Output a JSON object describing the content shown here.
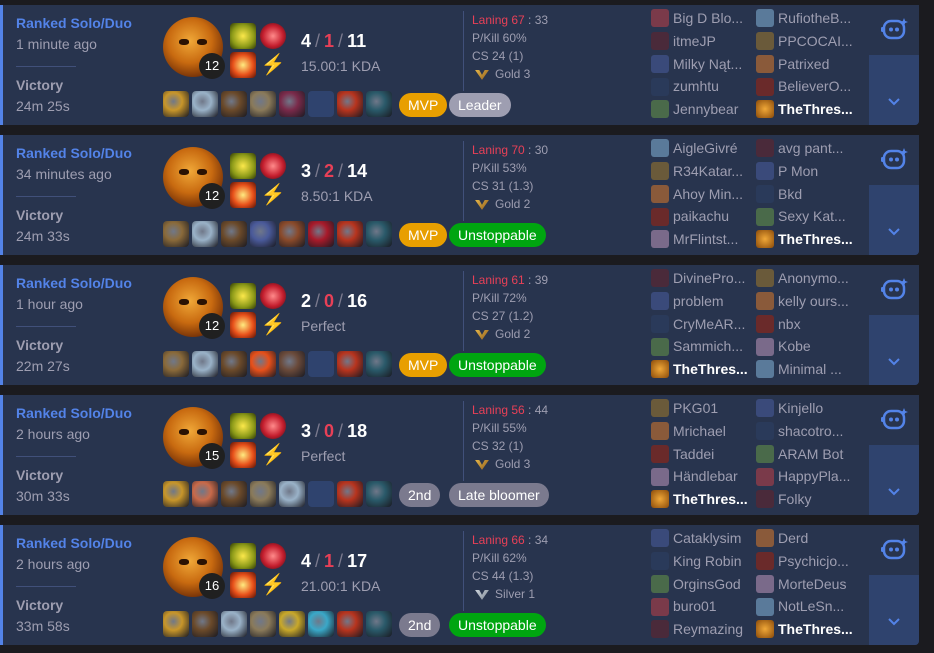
{
  "colors": {
    "accent": "#5383e8",
    "deaths": "#e84057",
    "mvp": "#e89f00",
    "second": "#7b7a8e",
    "green": "#00a510",
    "background": "#28344e"
  },
  "icons": {
    "ai": "ai-assistant-icon",
    "expand": "chevron-down-icon",
    "rank": "rank-emblem-icon"
  },
  "matches": [
    {
      "queue": "Ranked Solo/Duo",
      "ago": "1 minute ago",
      "result": "Victory",
      "duration": "24m 25s",
      "level": "12",
      "kills": "4",
      "deaths": "1",
      "assists": "11",
      "ratio": "15.00:1 KDA",
      "lane_label": "Laning 67",
      "lane_other": "33",
      "pkill": "P/Kill 60%",
      "cs": "CS 24 (1)",
      "rank": "Gold 3",
      "rank_tier": "gold",
      "badges": [
        {
          "label": "MVP",
          "type": "mvp"
        },
        {
          "label": "Leader",
          "type": "grey"
        }
      ],
      "items": [
        "#c8962a",
        "#9ab2c8",
        "#6b4a2a",
        "#8a7a5a",
        "#7a2a4a",
        "",
        "#b8341e",
        "#2a5a6a"
      ],
      "players": [
        [
          "Big D Blo...",
          "RufiotheB..."
        ],
        [
          "itmeJP",
          "PPCOCAI..."
        ],
        [
          "Milky Nąt...",
          "Patrixed"
        ],
        [
          "zumhtu",
          "BelieverO..."
        ],
        [
          "Jennybear",
          "TheThres..."
        ]
      ],
      "me": [
        4,
        1
      ]
    },
    {
      "queue": "Ranked Solo/Duo",
      "ago": "34 minutes ago",
      "result": "Victory",
      "duration": "24m 33s",
      "level": "12",
      "kills": "3",
      "deaths": "2",
      "assists": "14",
      "ratio": "8.50:1 KDA",
      "lane_label": "Laning 70",
      "lane_other": "30",
      "pkill": "P/Kill 53%",
      "cs": "CS 31 (1.3)",
      "rank": "Gold 2",
      "rank_tier": "gold",
      "badges": [
        {
          "label": "MVP",
          "type": "mvp"
        },
        {
          "label": "Unstoppable",
          "type": "green"
        }
      ],
      "items": [
        "#8a6a3a",
        "#9ab2c8",
        "#6b4a2a",
        "#4a5a9a",
        "#8a4a2a",
        "#a81a2a",
        "#b8341e",
        "#2a5a6a"
      ],
      "players": [
        [
          "AigleGivré",
          "avg pant..."
        ],
        [
          "R34Katar...",
          "P Mon"
        ],
        [
          "Ahoy Min...",
          "Bkd"
        ],
        [
          "paikachu",
          "Sexy Kat..."
        ],
        [
          "MrFlintst...",
          "TheThres..."
        ]
      ],
      "me": [
        4,
        1
      ]
    },
    {
      "queue": "Ranked Solo/Duo",
      "ago": "1 hour ago",
      "result": "Victory",
      "duration": "22m 27s",
      "level": "12",
      "kills": "2",
      "deaths": "0",
      "assists": "16",
      "ratio": "Perfect",
      "lane_label": "Laning 61",
      "lane_other": "39",
      "pkill": "P/Kill 72%",
      "cs": "CS 27 (1.2)",
      "rank": "Gold 2",
      "rank_tier": "gold",
      "badges": [
        {
          "label": "MVP",
          "type": "mvp"
        },
        {
          "label": "Unstoppable",
          "type": "green"
        }
      ],
      "items": [
        "#8a6a3a",
        "#9ab2c8",
        "#6b4a2a",
        "#e8501a",
        "#6a4a3a",
        "",
        "#b8341e",
        "#2a5a6a"
      ],
      "players": [
        [
          "DivinePro...",
          "Anonymo..."
        ],
        [
          "problem",
          "kelly ours..."
        ],
        [
          "CryMeAR...",
          "nbx"
        ],
        [
          "Sammich...",
          "Kobe"
        ],
        [
          "TheThres...",
          "Minimal ..."
        ]
      ],
      "me": [
        4,
        0
      ]
    },
    {
      "queue": "Ranked Solo/Duo",
      "ago": "2 hours ago",
      "result": "Victory",
      "duration": "30m 33s",
      "level": "15",
      "kills": "3",
      "deaths": "0",
      "assists": "18",
      "ratio": "Perfect",
      "lane_label": "Laning 56",
      "lane_other": "44",
      "pkill": "P/Kill 55%",
      "cs": "CS 32 (1)",
      "rank": "Gold 3",
      "rank_tier": "gold",
      "badges": [
        {
          "label": "2nd",
          "type": "second"
        },
        {
          "label": "Late bloomer",
          "type": "second"
        }
      ],
      "items": [
        "#c8962a",
        "#c86a4a",
        "#6b4a2a",
        "#8a7a5a",
        "#9ab2c8",
        "",
        "#b8341e",
        "#2a5a6a"
      ],
      "players": [
        [
          "PKG01",
          "Kinjello"
        ],
        [
          "Mrichael",
          "shacotro..."
        ],
        [
          "Taddei",
          "ARAM Bot"
        ],
        [
          "Händlebar",
          "HappyPla..."
        ],
        [
          "TheThres...",
          "Folky"
        ]
      ],
      "me": [
        4,
        0
      ]
    },
    {
      "queue": "Ranked Solo/Duo",
      "ago": "2 hours ago",
      "result": "Victory",
      "duration": "33m 58s",
      "level": "16",
      "kills": "4",
      "deaths": "1",
      "assists": "17",
      "ratio": "21.00:1 KDA",
      "lane_label": "Laning 66",
      "lane_other": "34",
      "pkill": "P/Kill 62%",
      "cs": "CS 44 (1.3)",
      "rank": "Silver 1",
      "rank_tier": "silver",
      "badges": [
        {
          "label": "2nd",
          "type": "second"
        },
        {
          "label": "Unstoppable",
          "type": "green"
        }
      ],
      "items": [
        "#c8962a",
        "#6b4a2a",
        "#9ab2c8",
        "#8a7a5a",
        "#c8a82a",
        "#3aa8c8",
        "#b8341e",
        "#2a5a6a"
      ],
      "players": [
        [
          "Cataklysim",
          "Derd"
        ],
        [
          "King Robin",
          "Psychicjo..."
        ],
        [
          "OrginsGod",
          "MorteDeus"
        ],
        [
          "buro01",
          "NotLeSn..."
        ],
        [
          "Reymazing",
          "TheThres..."
        ]
      ],
      "me": [
        4,
        1
      ]
    }
  ]
}
